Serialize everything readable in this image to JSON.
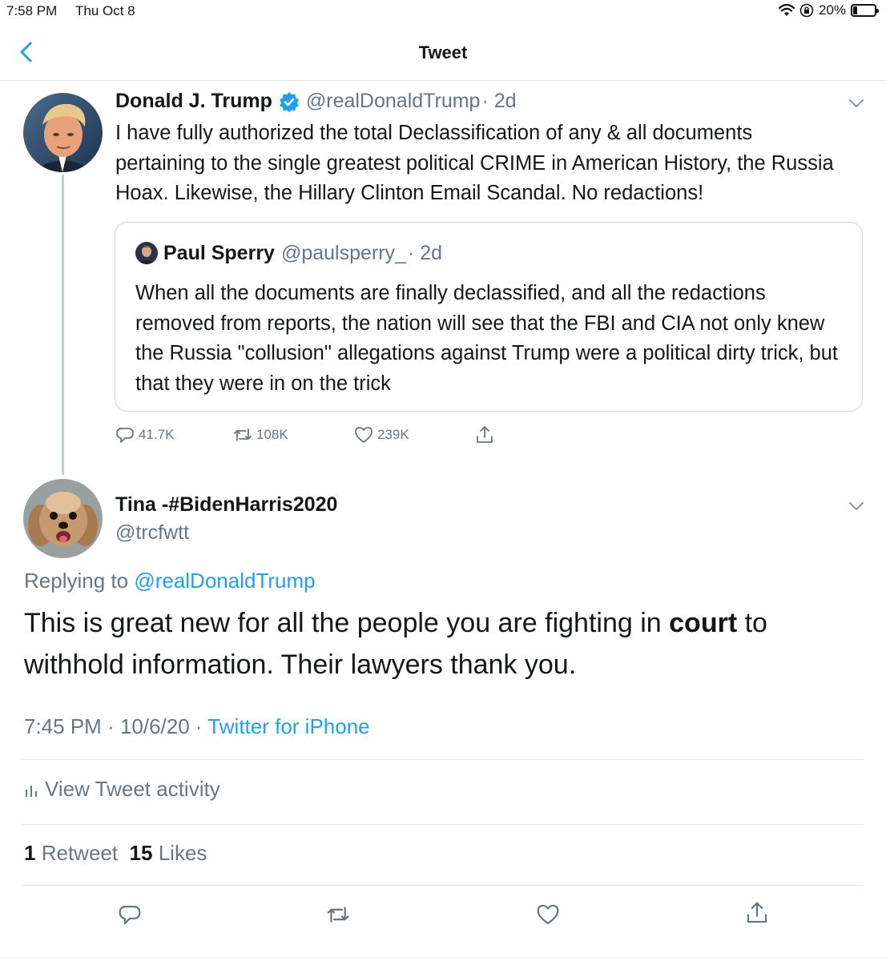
{
  "status_bar": {
    "time": "7:58 PM",
    "date": "Thu Oct 8",
    "battery": "20%",
    "battery_level": 0.2
  },
  "nav": {
    "title": "Tweet",
    "back_icon": "chevron-left-icon"
  },
  "parent_tweet": {
    "name": "Donald J. Trump",
    "verified_icon": "verified-badge-icon",
    "handle": "@realDonaldTrump",
    "time": "· 2d",
    "text": "I have fully authorized the total Declassification of any & all documents pertaining to the single greatest political CRIME in American History, the Russia Hoax. Likewise, the Hillary Clinton Email Scandal. No redactions!",
    "quote": {
      "name": "Paul Sperry",
      "handle": "@paulsperry_",
      "time": "· 2d",
      "text": "When all the documents are finally declassified, and all the redactions removed from reports, the nation will see that the FBI and CIA not only knew the Russia \"collusion\" allegations against Trump were a political dirty trick, but that they were in on the trick"
    },
    "actions": {
      "replies": "41.7K",
      "retweets": "108K",
      "likes": "239K"
    }
  },
  "reply_tweet": {
    "name": "Tina -#BidenHarris2020",
    "handle": "@trcfwtt",
    "replying_label": "Replying to",
    "replying_to": "@realDonaldTrump",
    "text_before": "This is great new for all the people you are fighting in ",
    "text_bold": "court",
    "text_after": " to withhold information. Their lawyers thank you.",
    "time": "7:45 PM",
    "date": "10/6/20",
    "source": "Twitter for iPhone",
    "activity_label": "View Tweet activity",
    "retweet_count": "1",
    "retweet_label": "Retweet",
    "like_count": "15",
    "like_label": "Likes"
  },
  "colors": {
    "accent": "#1da1f2",
    "secondary_text": "#657786",
    "divider": "#e1e8ed"
  }
}
